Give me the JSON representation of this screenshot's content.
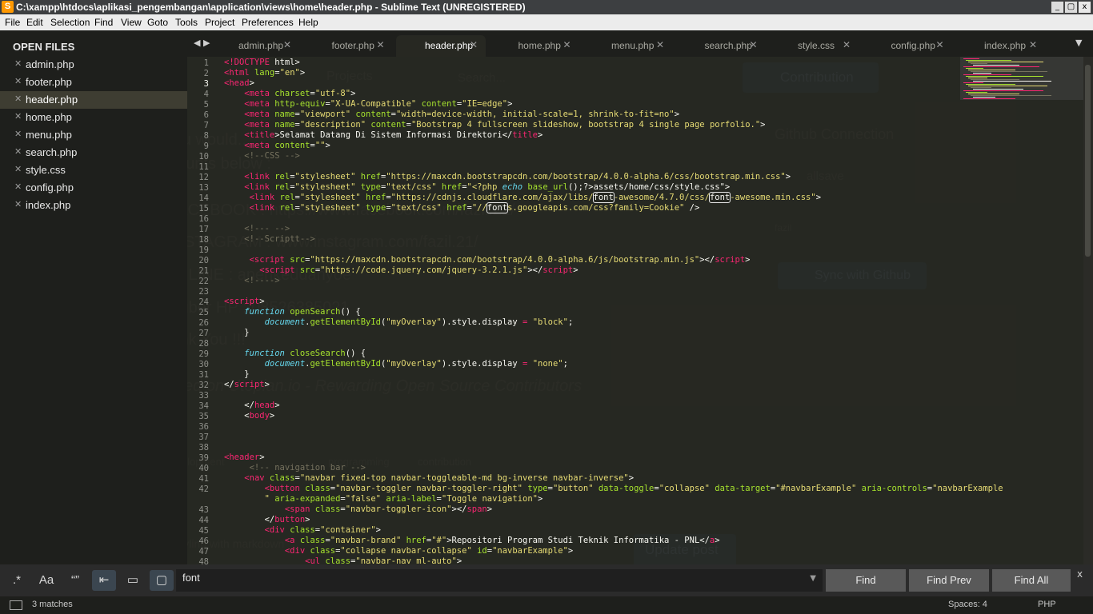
{
  "window": {
    "title": "C:\\xampp\\htdocs\\aplikasi_pengembangan\\application\\views\\home\\header.php - Sublime Text (UNREGISTERED)",
    "min": "_",
    "max": "▢",
    "close": "x"
  },
  "menu": [
    "File",
    "Edit",
    "Selection",
    "Find",
    "View",
    "Goto",
    "Tools",
    "Project",
    "Preferences",
    "Help"
  ],
  "sidebar": {
    "header": "OPEN FILES",
    "files": [
      {
        "name": "admin.php",
        "active": false
      },
      {
        "name": "footer.php",
        "active": false
      },
      {
        "name": "header.php",
        "active": true
      },
      {
        "name": "home.php",
        "active": false
      },
      {
        "name": "menu.php",
        "active": false
      },
      {
        "name": "search.php",
        "active": false
      },
      {
        "name": "style.css",
        "active": false
      },
      {
        "name": "config.php",
        "active": false
      },
      {
        "name": "index.php",
        "active": false
      }
    ]
  },
  "tabs": [
    {
      "name": "admin.php",
      "active": false
    },
    {
      "name": "footer.php",
      "active": false
    },
    {
      "name": "header.php",
      "active": true
    },
    {
      "name": "home.php",
      "active": false
    },
    {
      "name": "menu.php",
      "active": false
    },
    {
      "name": "search.php",
      "active": false
    },
    {
      "name": "style.css",
      "active": false
    },
    {
      "name": "config.php",
      "active": false
    },
    {
      "name": "index.php",
      "active": false
    }
  ],
  "editor": {
    "line_numbers": [
      "1",
      "2",
      "3",
      "4",
      "5",
      "6",
      "7",
      "8",
      "9",
      "10",
      "11",
      "12",
      "13",
      "14",
      "15",
      "16",
      "17",
      "18",
      "19",
      "20",
      "21",
      "22",
      "23",
      "24",
      "25",
      "26",
      "27",
      "28",
      "29",
      "30",
      "31",
      "32",
      "33",
      "34",
      "35",
      "36",
      "37",
      "38",
      "39",
      "40",
      "41",
      "42",
      "",
      "43",
      "44",
      "45",
      "46",
      "47",
      "48"
    ],
    "lines": [
      [
        [
          "tg",
          "<!DOCTYPE "
        ],
        [
          "pl",
          "html>"
        ]
      ],
      [
        [
          "tg",
          "<html "
        ],
        [
          "at",
          "lang"
        ],
        [
          "pl",
          "="
        ],
        [
          "st",
          "\"en\""
        ],
        [
          "pl",
          ">"
        ]
      ],
      [
        [
          "tg",
          "<head"
        ],
        [
          "pl",
          ">"
        ]
      ],
      [
        [
          "pl",
          "    "
        ],
        [
          "tg",
          "<meta "
        ],
        [
          "at",
          "charset"
        ],
        [
          "pl",
          "="
        ],
        [
          "st",
          "\"utf-8\""
        ],
        [
          "pl",
          ">"
        ]
      ],
      [
        [
          "pl",
          "    "
        ],
        [
          "tg",
          "<meta "
        ],
        [
          "at",
          "http-equiv"
        ],
        [
          "pl",
          "="
        ],
        [
          "st",
          "\"X-UA-Compatible\" "
        ],
        [
          "at",
          "content"
        ],
        [
          "pl",
          "="
        ],
        [
          "st",
          "\"IE=edge\""
        ],
        [
          "pl",
          ">"
        ]
      ],
      [
        [
          "pl",
          "    "
        ],
        [
          "tg",
          "<meta "
        ],
        [
          "at",
          "name"
        ],
        [
          "pl",
          "="
        ],
        [
          "st",
          "\"viewport\" "
        ],
        [
          "at",
          "content"
        ],
        [
          "pl",
          "="
        ],
        [
          "st",
          "\"width=device-width, initial-scale=1, shrink-to-fit=no\""
        ],
        [
          "pl",
          ">"
        ]
      ],
      [
        [
          "pl",
          "    "
        ],
        [
          "tg",
          "<meta "
        ],
        [
          "at",
          "name"
        ],
        [
          "pl",
          "="
        ],
        [
          "st",
          "\"description\" "
        ],
        [
          "at",
          "content"
        ],
        [
          "pl",
          "="
        ],
        [
          "st",
          "\"Bootstrap 4 fullscreen slideshow, bootstrap 4 single page porfolio.\""
        ],
        [
          "pl",
          ">"
        ]
      ],
      [
        [
          "pl",
          "    "
        ],
        [
          "tg",
          "<title"
        ],
        [
          "pl",
          ">Selamat Datang Di Sistem Informasi Direktori</"
        ],
        [
          "tg",
          "title"
        ],
        [
          "pl",
          ">"
        ]
      ],
      [
        [
          "pl",
          "    "
        ],
        [
          "tg",
          "<meta "
        ],
        [
          "at",
          "content"
        ],
        [
          "pl",
          "="
        ],
        [
          "st",
          "\"\""
        ],
        [
          "pl",
          ">"
        ]
      ],
      [
        [
          "pl",
          "    "
        ],
        [
          "cm",
          "<!--CSS -->"
        ]
      ],
      [
        [
          "pl",
          ""
        ]
      ],
      [
        [
          "pl",
          "    "
        ],
        [
          "tg",
          "<link "
        ],
        [
          "at",
          "rel"
        ],
        [
          "pl",
          "="
        ],
        [
          "st",
          "\"stylesheet\" "
        ],
        [
          "at",
          "href"
        ],
        [
          "pl",
          "="
        ],
        [
          "st",
          "\"https://maxcdn.bootstrapcdn.com/bootstrap/4.0.0-alpha.6/css/bootstrap.min.css\""
        ],
        [
          "pl",
          ">"
        ]
      ],
      [
        [
          "pl",
          "    "
        ],
        [
          "tg",
          "<link "
        ],
        [
          "at",
          "rel"
        ],
        [
          "pl",
          "="
        ],
        [
          "st",
          "\"stylesheet\" "
        ],
        [
          "at",
          "type"
        ],
        [
          "pl",
          "="
        ],
        [
          "st",
          "\"text/css\" "
        ],
        [
          "at",
          "href"
        ],
        [
          "pl",
          "="
        ],
        [
          "st",
          "\"<?php "
        ],
        [
          "kw",
          "echo "
        ],
        [
          "fn",
          "base_url"
        ],
        [
          "pl",
          "();?>assets/home/css/style.css\">"
        ]
      ],
      [
        [
          "pl",
          "     "
        ],
        [
          "tg",
          "<link "
        ],
        [
          "at",
          "rel"
        ],
        [
          "pl",
          "="
        ],
        [
          "st",
          "\"stylesheet\" "
        ],
        [
          "at",
          "href"
        ],
        [
          "pl",
          "="
        ],
        [
          "st",
          "\"https://cdnjs.cloudflare.com/ajax/libs/"
        ],
        [
          "hl",
          "font"
        ],
        [
          "st",
          "-awesome/4.7.0/css/"
        ],
        [
          "hl",
          "font"
        ],
        [
          "st",
          "-awesome.min.css\""
        ],
        [
          "pl",
          ">"
        ]
      ],
      [
        [
          "pl",
          "     "
        ],
        [
          "tg",
          "<link "
        ],
        [
          "at",
          "rel"
        ],
        [
          "pl",
          "="
        ],
        [
          "st",
          "\"stylesheet\" "
        ],
        [
          "at",
          "type"
        ],
        [
          "pl",
          "="
        ],
        [
          "st",
          "\"text/css\" "
        ],
        [
          "at",
          "href"
        ],
        [
          "pl",
          "="
        ],
        [
          "st",
          "\"//"
        ],
        [
          "hl",
          "font"
        ],
        [
          "st",
          "s.googleapis.com/css?family=Cookie\""
        ],
        [
          "pl",
          " />"
        ]
      ],
      [
        [
          "pl",
          ""
        ]
      ],
      [
        [
          "pl",
          "    "
        ],
        [
          "cm",
          "<!--- -->"
        ]
      ],
      [
        [
          "pl",
          "    "
        ],
        [
          "cm",
          "<!--Scriptt-->"
        ]
      ],
      [
        [
          "pl",
          ""
        ]
      ],
      [
        [
          "pl",
          "     "
        ],
        [
          "tg",
          "<script "
        ],
        [
          "at",
          "src"
        ],
        [
          "pl",
          "="
        ],
        [
          "st",
          "\"https://maxcdn.bootstrapcdn.com/bootstrap/4.0.0-alpha.6/js/bootstrap.min.js\""
        ],
        [
          "pl",
          "></"
        ],
        [
          "tg",
          "script"
        ],
        [
          "pl",
          ">"
        ]
      ],
      [
        [
          "pl",
          "       "
        ],
        [
          "tg",
          "<script "
        ],
        [
          "at",
          "src"
        ],
        [
          "pl",
          "="
        ],
        [
          "st",
          "\"https://code.jquery.com/jquery-3.2.1.js\""
        ],
        [
          "pl",
          "></"
        ],
        [
          "tg",
          "script"
        ],
        [
          "pl",
          ">"
        ]
      ],
      [
        [
          "pl",
          "    "
        ],
        [
          "cm",
          "<!---->"
        ]
      ],
      [
        [
          "pl",
          ""
        ]
      ],
      [
        [
          "tg",
          "<script"
        ],
        [
          "pl",
          ">"
        ]
      ],
      [
        [
          "pl",
          "    "
        ],
        [
          "kw",
          "function "
        ],
        [
          "fn",
          "openSearch"
        ],
        [
          "pl",
          "() {"
        ]
      ],
      [
        [
          "pl",
          "        "
        ],
        [
          "kw",
          "document"
        ],
        [
          "pl",
          "."
        ],
        [
          "fn",
          "getElementById"
        ],
        [
          "pl",
          "("
        ],
        [
          "st",
          "\"myOverlay\""
        ],
        [
          "pl",
          ").style.display "
        ],
        [
          "tg",
          "= "
        ],
        [
          "st",
          "\"block\""
        ],
        [
          "pl",
          ";"
        ]
      ],
      [
        [
          "pl",
          "    }"
        ]
      ],
      [
        [
          "pl",
          ""
        ]
      ],
      [
        [
          "pl",
          "    "
        ],
        [
          "kw",
          "function "
        ],
        [
          "fn",
          "closeSearch"
        ],
        [
          "pl",
          "() {"
        ]
      ],
      [
        [
          "pl",
          "        "
        ],
        [
          "kw",
          "document"
        ],
        [
          "pl",
          "."
        ],
        [
          "fn",
          "getElementById"
        ],
        [
          "pl",
          "("
        ],
        [
          "st",
          "\"myOverlay\""
        ],
        [
          "pl",
          ").style.display "
        ],
        [
          "tg",
          "= "
        ],
        [
          "st",
          "\"none\""
        ],
        [
          "pl",
          ";"
        ]
      ],
      [
        [
          "pl",
          "    }"
        ]
      ],
      [
        [
          "pl",
          "</"
        ],
        [
          "tg",
          "script"
        ],
        [
          "pl",
          ">"
        ]
      ],
      [
        [
          "pl",
          ""
        ]
      ],
      [
        [
          "pl",
          "    </"
        ],
        [
          "tg",
          "head"
        ],
        [
          "pl",
          ">"
        ]
      ],
      [
        [
          "pl",
          "    <"
        ],
        [
          "tg",
          "body"
        ],
        [
          "pl",
          ">"
        ]
      ],
      [
        [
          "pl",
          ""
        ]
      ],
      [
        [
          "pl",
          ""
        ]
      ],
      [
        [
          "pl",
          ""
        ]
      ],
      [
        [
          "tg",
          "<header"
        ],
        [
          "pl",
          ">"
        ]
      ],
      [
        [
          "pl",
          "     "
        ],
        [
          "cm",
          "<!-- navigation bar -->"
        ]
      ],
      [
        [
          "pl",
          "    "
        ],
        [
          "tg",
          "<nav "
        ],
        [
          "at",
          "class"
        ],
        [
          "pl",
          "="
        ],
        [
          "st",
          "\"navbar fixed-top navbar-toggleable-md bg-inverse navbar-inverse\""
        ],
        [
          "pl",
          ">"
        ]
      ],
      [
        [
          "pl",
          "        "
        ],
        [
          "tg",
          "<button "
        ],
        [
          "at",
          "class"
        ],
        [
          "pl",
          "="
        ],
        [
          "st",
          "\"navbar-toggler navbar-toggler-right\" "
        ],
        [
          "at",
          "type"
        ],
        [
          "pl",
          "="
        ],
        [
          "st",
          "\"button\" "
        ],
        [
          "at",
          "data-toggle"
        ],
        [
          "pl",
          "="
        ],
        [
          "st",
          "\"collapse\" "
        ],
        [
          "at",
          "data-target"
        ],
        [
          "pl",
          "="
        ],
        [
          "st",
          "\"#navbarExample\" "
        ],
        [
          "at",
          "aria-controls"
        ],
        [
          "pl",
          "="
        ],
        [
          "st",
          "\"navbarExample"
        ]
      ],
      [
        [
          "pl",
          "        "
        ],
        [
          "st",
          "\" "
        ],
        [
          "at",
          "aria-expanded"
        ],
        [
          "pl",
          "="
        ],
        [
          "st",
          "\"false\" "
        ],
        [
          "at",
          "aria-label"
        ],
        [
          "pl",
          "="
        ],
        [
          "st",
          "\"Toggle navigation\""
        ],
        [
          "pl",
          ">"
        ]
      ],
      [
        [
          "pl",
          "            "
        ],
        [
          "tg",
          "<span "
        ],
        [
          "at",
          "class"
        ],
        [
          "pl",
          "="
        ],
        [
          "st",
          "\"navbar-toggler-icon\""
        ],
        [
          "pl",
          "></"
        ],
        [
          "tg",
          "span"
        ],
        [
          "pl",
          ">"
        ]
      ],
      [
        [
          "pl",
          "        </"
        ],
        [
          "tg",
          "button"
        ],
        [
          "pl",
          ">"
        ]
      ],
      [
        [
          "pl",
          "        "
        ],
        [
          "tg",
          "<div "
        ],
        [
          "at",
          "class"
        ],
        [
          "pl",
          "="
        ],
        [
          "st",
          "\"container\""
        ],
        [
          "pl",
          ">"
        ]
      ],
      [
        [
          "pl",
          "            "
        ],
        [
          "tg",
          "<a "
        ],
        [
          "at",
          "class"
        ],
        [
          "pl",
          "="
        ],
        [
          "st",
          "\"navbar-brand\" "
        ],
        [
          "at",
          "href"
        ],
        [
          "pl",
          "="
        ],
        [
          "st",
          "\"#\""
        ],
        [
          "pl",
          ">Repositori Program Studi Teknik Informatika - PNL</"
        ],
        [
          "tg",
          "a"
        ],
        [
          "pl",
          ">"
        ]
      ],
      [
        [
          "pl",
          "            "
        ],
        [
          "tg",
          "<div "
        ],
        [
          "at",
          "class"
        ],
        [
          "pl",
          "="
        ],
        [
          "st",
          "\"collapse navbar-collapse\" "
        ],
        [
          "at",
          "id"
        ],
        [
          "pl",
          "="
        ],
        [
          "st",
          "\"navbarExample\""
        ],
        [
          "pl",
          ">"
        ]
      ],
      [
        [
          "pl",
          "                "
        ],
        [
          "tg",
          "<ul "
        ],
        [
          "at",
          "class"
        ],
        [
          "pl",
          "="
        ],
        [
          "st",
          "\"navbar-nav ml-auto\""
        ],
        [
          "pl",
          ">"
        ]
      ]
    ]
  },
  "find": {
    "options": [
      ".*",
      "Aa",
      "“”",
      "⇤",
      "▭",
      "▢"
    ],
    "query": "font",
    "find_label": "Find",
    "find_prev_label": "Find Prev",
    "find_all_label": "Find All",
    "close": "x"
  },
  "status": {
    "matches": "3 matches",
    "spaces": "Spaces: 4",
    "syntax": "PHP"
  },
  "background_ghost": {
    "texts": [
      "Projects",
      "Search...",
      "Contribution",
      "Github Connection",
      "allsave",
      "fazil",
      "Sync with Github",
      "If you would...",
      "accounts below :",
      "FACEBOOK : https://www.facebook.com/fazil.21/",
      "INSTAGRAM : www.instagram.com/fazil.21/",
      "ID LINE : anehkeduanyoe",
      "Nuber HP : 08526385021",
      "Thank You !!!",
      "Posted on Utopian.io - Rewarding Open Source Contributors",
      "Tags",
      "development",
      "programming",
      "contribution",
      "Styling with markdown",
      "Update post",
      "utopian.io/write-task/118263305",
      "drive",
      "Aturan",
      "Tutorial",
      "Aplikasi",
      "Utopian",
      "Bootstrap",
      "Chats"
    ]
  }
}
